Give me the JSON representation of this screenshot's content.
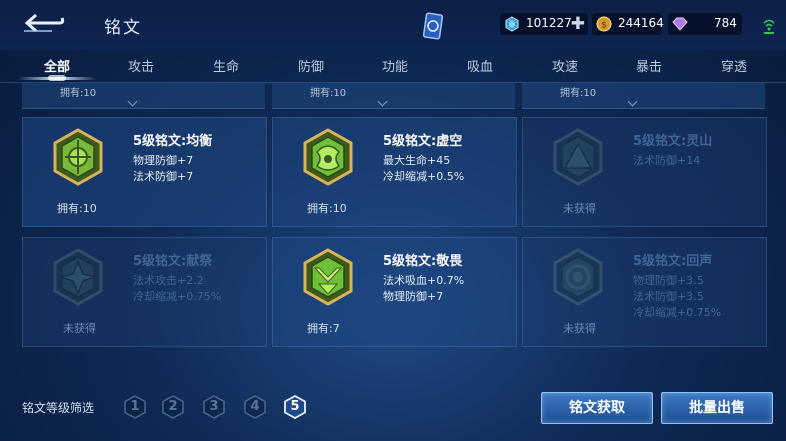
{
  "header": {
    "title": "铭文",
    "currency": {
      "diamond": "101227",
      "gold": "244164",
      "crystal": "784"
    }
  },
  "tabs": [
    "全部",
    "攻击",
    "生命",
    "防御",
    "功能",
    "吸血",
    "攻速",
    "暴击",
    "穿透"
  ],
  "partial_row": [
    "拥有:10",
    "拥有:10",
    "拥有:10"
  ],
  "runes": [
    {
      "name": "5级铭文:均衡",
      "stats": [
        "物理防御+7",
        "法术防御+7"
      ],
      "owned": "拥有:10",
      "locked": false,
      "icon": "rune-balance-icon"
    },
    {
      "name": "5级铭文:虚空",
      "stats": [
        "最大生命+45",
        "冷却缩减+0.5%"
      ],
      "owned": "拥有:10",
      "locked": false,
      "icon": "rune-void-icon"
    },
    {
      "name": "5级铭文:灵山",
      "stats": [
        "法术防御+14"
      ],
      "owned": "未获得",
      "locked": true,
      "icon": "rune-mountain-icon"
    },
    {
      "name": "5级铭文:献祭",
      "stats": [
        "法术攻击+2.2",
        "冷却缩减+0.75%"
      ],
      "owned": "未获得",
      "locked": true,
      "icon": "rune-sacrifice-icon"
    },
    {
      "name": "5级铭文:敬畏",
      "stats": [
        "法术吸血+0.7%",
        "物理防御+7"
      ],
      "owned": "拥有:7",
      "locked": false,
      "icon": "rune-awe-icon"
    },
    {
      "name": "5级铭文:回声",
      "stats": [
        "物理防御+3.5",
        "法术防御+3.5",
        "冷却缩减+0.75%"
      ],
      "owned": "未获得",
      "locked": true,
      "icon": "rune-echo-icon"
    }
  ],
  "footer": {
    "filter_label": "铭文等级筛选",
    "levels": [
      "1",
      "2",
      "3",
      "4",
      "5"
    ],
    "selected_level": "5",
    "get_button": "铭文获取",
    "sell_button": "批量出售"
  },
  "colors": {
    "accent": "#2d66b0",
    "gold": "#c9a24a",
    "rune_green": "#6fbf3a"
  }
}
